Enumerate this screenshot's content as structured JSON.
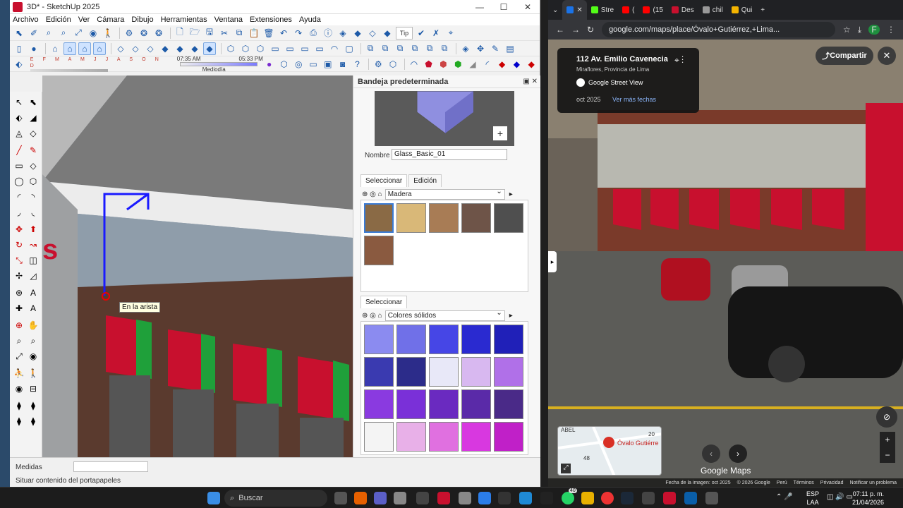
{
  "sketchup": {
    "title": "3D* - SketchUp 2025",
    "window_controls": [
      "—",
      "☐",
      "✕"
    ],
    "menu": [
      "Archivo",
      "Edición",
      "Ver",
      "Cámara",
      "Dibujo",
      "Herramientas",
      "Ventana",
      "Extensiones",
      "Ayuda"
    ],
    "shadow": {
      "months": "E F M A M J J A S O N D",
      "start": "07:35 AM",
      "mid": "Mediodía",
      "end": "05:33 PM"
    },
    "type_label": "Tip",
    "tooltip": "En la arista",
    "status": {
      "measures_label": "Medidas",
      "message": "Situar contenido del portapapeles"
    },
    "tray": {
      "title": "Bandeja predeterminada",
      "name_label": "Nombre",
      "name_value": "Glass_Basic_01",
      "tab_select": "Seleccionar",
      "tab_edit": "Edición",
      "library_1": "Madera",
      "library_2_label": "Seleccionar",
      "library_2": "Colores sólidos",
      "wood_swatches": [
        "#8a6a45",
        "#d9b878",
        "#a87c55",
        "#6e5448",
        "#4f4f4f",
        "#8a5a40"
      ],
      "color_swatches": [
        "#8b8bf0",
        "#7070e8",
        "#4646e6",
        "#2a2ad0",
        "#2020b8",
        "#3a3ab0",
        "#2c2c8a",
        "#e8e8f8",
        "#d8b8f0",
        "#b070e8",
        "#8a3ae0",
        "#7a30d8",
        "#6a2ac0",
        "#5a2aa8",
        "#4a2a88",
        "#f4f4f4",
        "#e8b0e8",
        "#e070e0",
        "#d838e0",
        "#c020c8"
      ]
    }
  },
  "browser": {
    "tabs": [
      {
        "label": "",
        "color": "#1a73e8"
      },
      {
        "label": "",
        "color": "#202124",
        "close": "✕"
      },
      {
        "label": "Stre",
        "color": "#53fc18"
      },
      {
        "label": "(",
        "color": "#ff0000"
      },
      {
        "label": "(15",
        "color": "#ff0000"
      },
      {
        "label": "Des",
        "color": "#c8102e"
      },
      {
        "label": "chil",
        "color": "#999999"
      },
      {
        "label": "Qui",
        "color": "#f4b400"
      }
    ],
    "new_tab": "+",
    "url": "google.com/maps/place/Óvalo+Gutiérrez,+Lima...",
    "profile": "F",
    "card": {
      "address": "112 Av. Emilio Cavenecia",
      "district": "Miraflores, Provincia de Lima",
      "source": "Google Street View",
      "date": "oct 2025",
      "more_dates": "Ver más fechas"
    },
    "share": "Compartir",
    "close": "✕",
    "minimap": {
      "street": "ABEL",
      "place": "Óvalo Gutiérre",
      "n1": "20",
      "n2": "48"
    },
    "google_maps": "Google Maps",
    "footer": [
      "Fecha de la imagen: oct 2025",
      "© 2026 Google",
      "Perú",
      "Términos",
      "Privacidad",
      "Notificar un problema"
    ]
  },
  "taskbar": {
    "search": "Buscar",
    "lang_1": "ESP",
    "lang_2": "LAA",
    "time": "07:11 p. m.",
    "date": "21/04/2026",
    "badge": "40"
  }
}
